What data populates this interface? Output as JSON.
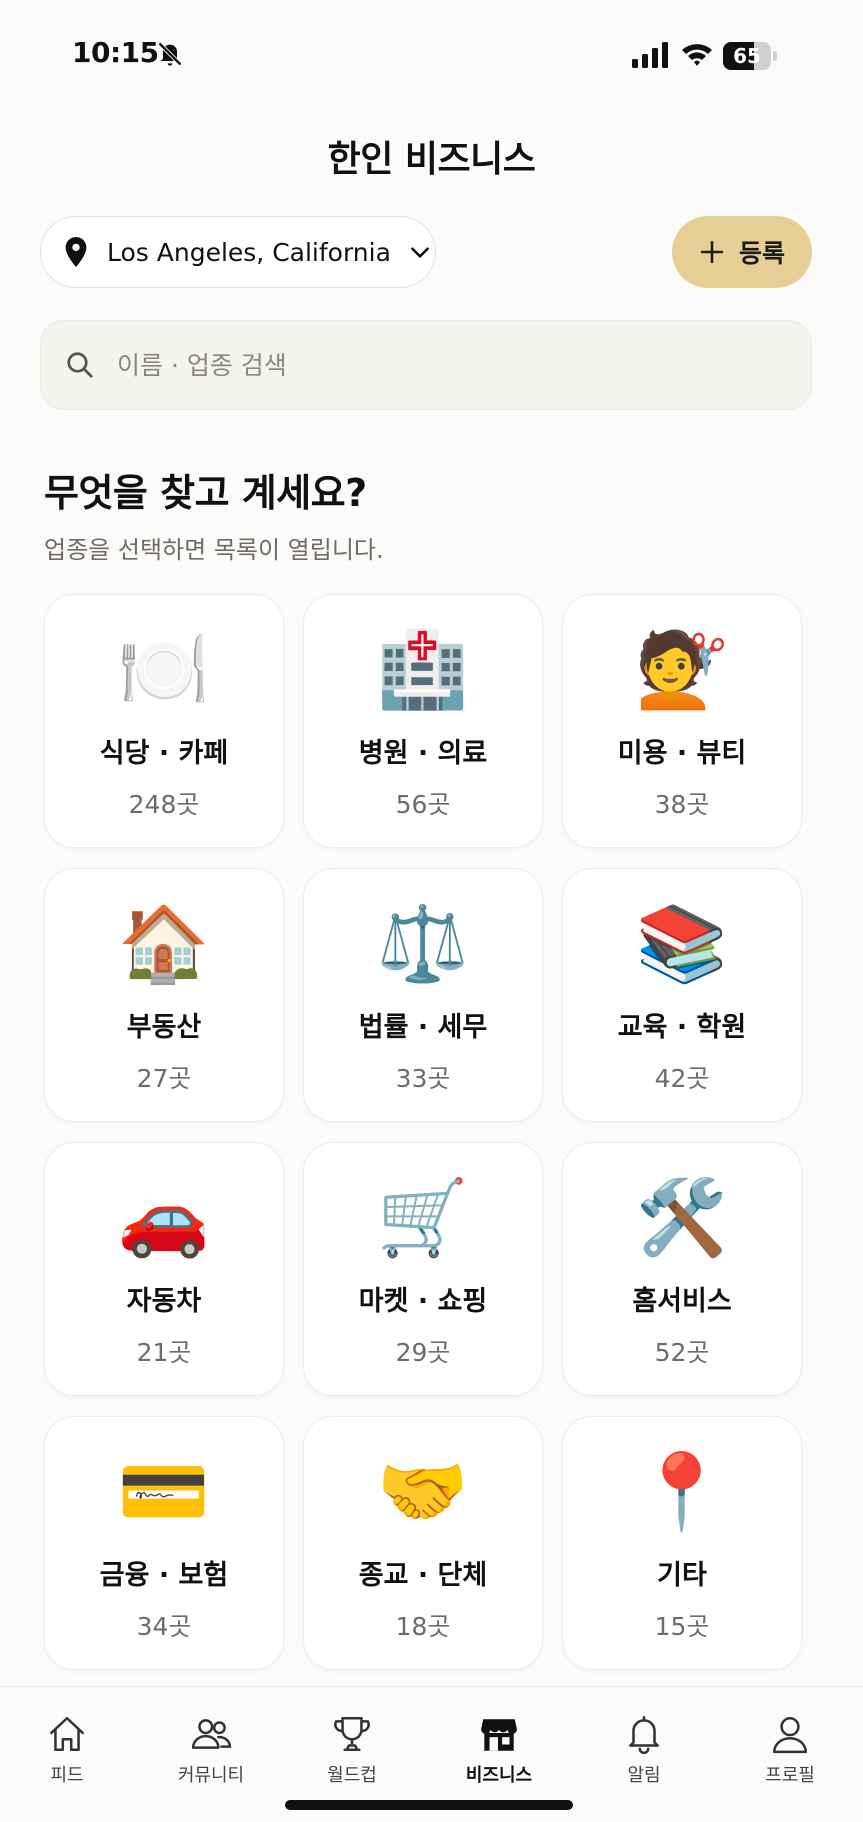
{
  "status_bar": {
    "time": "10:15",
    "battery_level": "65",
    "battery_fraction": 0.65
  },
  "header": {
    "title": "한인 비즈니스"
  },
  "location": {
    "label": "Los Angeles, California",
    "icon": "pin-icon"
  },
  "register_button": {
    "label": "등록",
    "icon": "plus-icon",
    "color": "#e6cf95"
  },
  "search": {
    "placeholder": "이름 · 업종 검색",
    "value": ""
  },
  "section": {
    "title": "무엇을 찾고 계세요?",
    "subtitle": "업종을 선택하면 목록이 열립니다."
  },
  "categories": [
    {
      "label": "식당 · 카페",
      "count": "248곳",
      "emoji": "🍽️"
    },
    {
      "label": "병원 · 의료",
      "count": "56곳",
      "emoji": "🏥"
    },
    {
      "label": "미용 · 뷰티",
      "count": "38곳",
      "emoji": "💇"
    },
    {
      "label": "부동산",
      "count": "27곳",
      "emoji": "🏠"
    },
    {
      "label": "법률 · 세무",
      "count": "33곳",
      "emoji": "⚖️"
    },
    {
      "label": "교육 · 학원",
      "count": "42곳",
      "emoji": "📚"
    },
    {
      "label": "자동차",
      "count": "21곳",
      "emoji": "🚗"
    },
    {
      "label": "마켓 · 쇼핑",
      "count": "29곳",
      "emoji": "🛒"
    },
    {
      "label": "홈서비스",
      "count": "52곳",
      "emoji": "🛠️"
    },
    {
      "label": "금융 · 보험",
      "count": "34곳",
      "emoji": "💳"
    },
    {
      "label": "종교 · 단체",
      "count": "18곳",
      "emoji": "🤝"
    },
    {
      "label": "기타",
      "count": "15곳",
      "emoji": "📍"
    }
  ],
  "bottom_nav": [
    {
      "label": "피드",
      "icon": "home-icon",
      "active": false
    },
    {
      "label": "커뮤니티",
      "icon": "users-icon",
      "active": false
    },
    {
      "label": "월드컵",
      "icon": "trophy-icon",
      "active": false
    },
    {
      "label": "비즈니스",
      "icon": "store-icon",
      "active": true
    },
    {
      "label": "알림",
      "icon": "bell-icon",
      "active": false
    },
    {
      "label": "프로필",
      "icon": "profile-icon",
      "active": false
    }
  ]
}
